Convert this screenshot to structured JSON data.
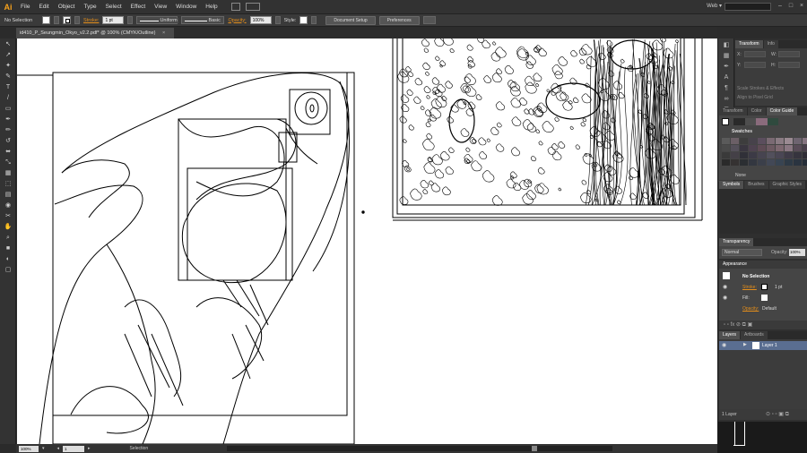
{
  "app": {
    "logo": "Ai",
    "workspace": "Web ▾"
  },
  "menu": [
    "File",
    "Edit",
    "Object",
    "Type",
    "Select",
    "Effect",
    "View",
    "Window",
    "Help"
  ],
  "window_buttons": [
    "–",
    "□",
    "×"
  ],
  "control_bar": {
    "selection_label": "No Selection",
    "stroke_label": "Stroke:",
    "stroke_value": "1 pt",
    "profile_label": "Uniform",
    "brush_label": "Basic",
    "opacity_label": "Opacity:",
    "opacity_value": "100%",
    "style_label": "Style:",
    "document_setup": "Document Setup",
    "preferences": "Preferences"
  },
  "document_tab": {
    "title": "id410_P_Seungmin_Okyo_v2.2.pdf* @ 100% (CMYK/Outline)",
    "close": "×"
  },
  "tools": [
    "↖",
    "↗",
    "✦",
    "✎",
    "T",
    "/",
    "▭",
    "✒",
    "✏",
    "↺",
    "⬌",
    "⤡",
    "▦",
    "⬚",
    "▤",
    "◉",
    "✂",
    "✋",
    "⌕",
    "■",
    "◐",
    "▢"
  ],
  "status_bar": {
    "zoom": "100%",
    "artboard": "1",
    "tool": "Selection"
  },
  "panels": {
    "transform_tabs": [
      "Transform",
      "Info"
    ],
    "transform_fields": [
      "X:",
      "Y:",
      "W:",
      "H:"
    ],
    "transform_checks": [
      "Scale Strokes & Effects",
      "Align to Pixel Grid"
    ],
    "color_tabs": [
      "Transform",
      "Color",
      "Color Guide"
    ],
    "swatches_title": "Swatches",
    "swatches_footer": "None",
    "swatch_colors": [
      "#5a5a5a",
      "#6b5f66",
      "#3d3d3d",
      "#47424b",
      "#5b4e5d",
      "#7a6a73",
      "#8a7b83",
      "#9a8a92",
      "#6e6470",
      "#857480",
      "#4a4a4a",
      "#55505a",
      "#3a3640",
      "#4e4250",
      "#5e4b55",
      "#6d5a62",
      "#7d6870",
      "#8a7782",
      "#594c58",
      "#4a3f4c",
      "#3a3a3a",
      "#444047",
      "#303038",
      "#3c3a46",
      "#474450",
      "#52505c",
      "#4a4654",
      "#3f3b48",
      "#36343e",
      "#2f2d36",
      "#2a2a2a",
      "#353232",
      "#2b2e32",
      "#333740",
      "#3b3f4a",
      "#424856",
      "#384452",
      "#2e3a46",
      "#2a3440",
      "#252d38"
    ],
    "symbols_tabs": [
      "Symbols",
      "Brushes",
      "Graphic Styles"
    ],
    "transparency_title": "Transparency",
    "blend_mode": "Normal",
    "opacity_label": "Opacity:",
    "opacity_value": "100%",
    "appearance_title": "Appearance",
    "appearance_selection": "No Selection",
    "appearance_stroke": "Stroke:",
    "appearance_stroke_value": "1 pt",
    "appearance_fill": "Fill:",
    "appearance_opacity": "Opacity:",
    "appearance_opacity_value": "Default",
    "layers_tabs": [
      "Layers",
      "Artboards"
    ],
    "layer_name": "Layer 1",
    "layers_footer": "1 Layer"
  },
  "colors": {
    "accent_orange": "#e58e1a",
    "layer_highlight": "#5a6e91",
    "canvas": "#ffffff"
  }
}
